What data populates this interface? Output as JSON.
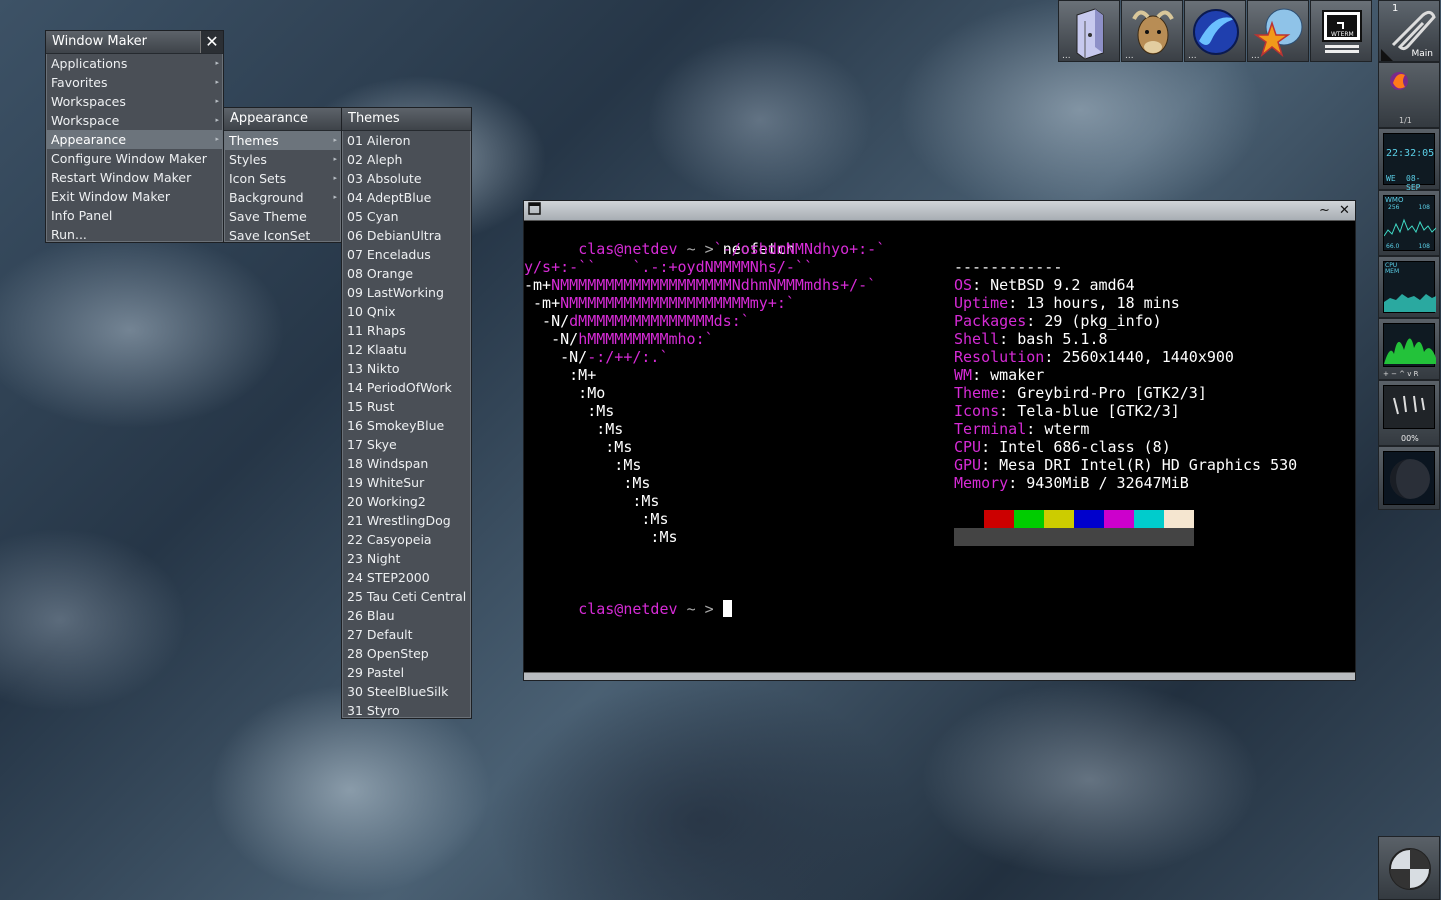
{
  "root_menu": {
    "title": "Window Maker",
    "close_glyph": "✕",
    "items": [
      {
        "label": "Applications",
        "submenu": true
      },
      {
        "label": "Favorites",
        "submenu": true
      },
      {
        "label": "Workspaces",
        "submenu": true
      },
      {
        "label": "Workspace",
        "submenu": true
      },
      {
        "label": "Appearance",
        "submenu": true,
        "selected": true
      },
      {
        "label": "Configure Window Maker",
        "submenu": false
      },
      {
        "label": "Restart Window Maker",
        "submenu": false
      },
      {
        "label": "Exit Window Maker",
        "submenu": false
      },
      {
        "label": "Info Panel",
        "submenu": false
      },
      {
        "label": "Run...",
        "submenu": false
      }
    ]
  },
  "appearance_menu": {
    "title": "Appearance",
    "items": [
      {
        "label": "Themes",
        "submenu": true,
        "selected": true
      },
      {
        "label": "Styles",
        "submenu": true
      },
      {
        "label": "Icon Sets",
        "submenu": true
      },
      {
        "label": "Background",
        "submenu": true
      },
      {
        "label": "Save Theme",
        "submenu": false
      },
      {
        "label": "Save IconSet",
        "submenu": false
      }
    ]
  },
  "themes_menu": {
    "title": "Themes",
    "items": [
      "01 Aileron",
      "02 Aleph",
      "03 Absolute",
      "04 AdeptBlue",
      "05 Cyan",
      "06 DebianUltra",
      "07 Enceladus",
      "08 Orange",
      "09 LastWorking",
      "10 Qnix",
      "11 Rhaps",
      "12 Klaatu",
      "13 Nikto",
      "14 PeriodOfWork",
      "15 Rust",
      "16 SmokeyBlue",
      "17 Skye",
      "18 Windspan",
      "19 WhiteSur",
      "20 Working2",
      "21 WrestlingDog",
      "22 Casyopeia",
      "23 Night",
      "24 STEP2000",
      "25 Tau Ceti Central",
      "26 Blau",
      "27 Default",
      "28 OpenStep",
      "29 Pastel",
      "30 SteelBlueSilk",
      "31 Styro"
    ]
  },
  "terminal": {
    "prompt_user": "clas@netdev",
    "prompt_dir": "~",
    "prompt_arrow": ">",
    "command": "neofetch",
    "title_buttons": {
      "minimize": "~",
      "close": "✕"
    },
    "logo_lines": [
      {
        "segments": [
          {
            "t": "                     `-/oshdmNMNdhyo+:-`",
            "c": "mag"
          }
        ]
      },
      {
        "segments": [
          {
            "t": "y/s+:-``    `.-:+oydNMMMMNhs/-``",
            "c": "mag",
            "w": "y/s+:-``"
          }
        ]
      },
      {
        "segments": [
          {
            "t": "-m+",
            "c": "wht"
          },
          {
            "t": "NMMMMMMMMMMMMMMMMMMMNdhmNMMMmdhs+/-`",
            "c": "mag"
          }
        ]
      },
      {
        "segments": [
          {
            "t": " -m+",
            "c": "wht"
          },
          {
            "t": "NMMMMMMMMMMMMMMMMMMMMmy+:`",
            "c": "mag"
          }
        ]
      },
      {
        "segments": [
          {
            "t": "  -N/",
            "c": "wht"
          },
          {
            "t": "dMMMMMMMMMMMMMMMds:`",
            "c": "mag"
          }
        ]
      },
      {
        "segments": [
          {
            "t": "   -N/",
            "c": "wht"
          },
          {
            "t": "hMMMMMMMMMmho:`",
            "c": "mag"
          }
        ]
      },
      {
        "segments": [
          {
            "t": "    -N/",
            "c": "wht"
          },
          {
            "t": "-:/++/:.`",
            "c": "mag"
          }
        ]
      },
      {
        "segments": [
          {
            "t": "     :M+",
            "c": "wht"
          }
        ]
      },
      {
        "segments": [
          {
            "t": "      :Mo",
            "c": "wht"
          }
        ]
      },
      {
        "segments": [
          {
            "t": "       :Ms",
            "c": "wht"
          }
        ]
      },
      {
        "segments": [
          {
            "t": "        :Ms",
            "c": "wht"
          }
        ]
      },
      {
        "segments": [
          {
            "t": "         :Ms",
            "c": "wht"
          }
        ]
      },
      {
        "segments": [
          {
            "t": "          :Ms",
            "c": "wht"
          }
        ]
      },
      {
        "segments": [
          {
            "t": "           :Ms",
            "c": "wht"
          }
        ]
      },
      {
        "segments": [
          {
            "t": "            :Ms",
            "c": "wht"
          }
        ]
      },
      {
        "segments": [
          {
            "t": "             :Ms",
            "c": "wht"
          }
        ]
      },
      {
        "segments": [
          {
            "t": "              :Ms",
            "c": "wht"
          }
        ]
      }
    ],
    "separator": "------------",
    "info": [
      {
        "key": "OS",
        "value": "NetBSD 9.2 amd64"
      },
      {
        "key": "Uptime",
        "value": "13 hours, 18 mins"
      },
      {
        "key": "Packages",
        "value": "29 (pkg_info)"
      },
      {
        "key": "Shell",
        "value": "bash 5.1.8"
      },
      {
        "key": "Resolution",
        "value": "2560x1440, 1440x900"
      },
      {
        "key": "WM",
        "value": "wmaker"
      },
      {
        "key": "Theme",
        "value": "Greybird-Pro [GTK2/3]"
      },
      {
        "key": "Icons",
        "value": "Tela-blue [GTK2/3]"
      },
      {
        "key": "Terminal",
        "value": "wterm"
      },
      {
        "key": "CPU",
        "value": "Intel 686-class (8)"
      },
      {
        "key": "GPU",
        "value": "Mesa DRI Intel(R) HD Graphics 530"
      },
      {
        "key": "Memory",
        "value": "9430MiB / 32647MiB"
      }
    ],
    "palette": [
      "#000000",
      "#cc0000",
      "#00cc00",
      "#cccc00",
      "#0000cc",
      "#cc00cc",
      "#00cccc",
      "#f5e6d0"
    ],
    "palette_bright": [
      "#444444",
      "#444444",
      "#444444",
      "#444444",
      "#444444",
      "#444444",
      "#444444",
      "#444444"
    ]
  },
  "top_dock": [
    {
      "name": "file-manager-icon"
    },
    {
      "name": "gnu-icon"
    },
    {
      "name": "seamonkey-icon"
    },
    {
      "name": "star-browser-icon"
    },
    {
      "name": "wterm-icon",
      "label": "WTERM"
    }
  ],
  "clip": {
    "workspace_number": "1",
    "workspace_name": "Main",
    "pager": "1/1"
  },
  "dockapps": {
    "clock_time": "22:32:05",
    "clock_day": "WE",
    "clock_date": "08-SEP",
    "net_label": "WMO",
    "net_left": "256",
    "net_right": "108",
    "net_bottom_left": "66.0",
    "net_bottom_right": "108",
    "cpu_label": "CPU",
    "mem_label": "MEM",
    "meter_value": "00%"
  }
}
